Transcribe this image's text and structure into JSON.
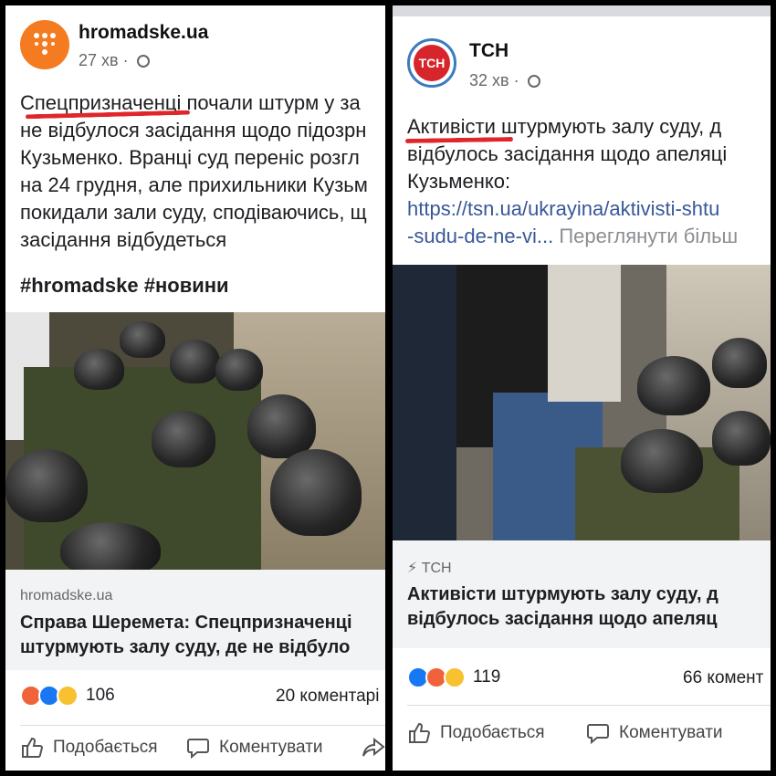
{
  "left_post": {
    "page_name": "hromadske.ua",
    "time": "27 хв",
    "text_lines": [
      "Спецпризначенці почали штурм у за",
      "не відбулося засідання щодо підозрн",
      "Кузьменко. Вранці суд переніс розгл",
      "на 24 грудня, але прихильники Кузьм",
      "покидали зали суду, сподіваючись, щ",
      "засідання відбудеться"
    ],
    "hashtags": "#hromadske #новини",
    "card_domain": "hromadske.ua",
    "card_title_lines": [
      "Справа Шеремета: Спецпризначенці",
      "штурмують залу суду, де не відбуло"
    ],
    "reaction_count": "106",
    "comments": "20 коментарі",
    "like_label": "Подобається",
    "comment_label": "Коментувати",
    "colors": {
      "avatar": "#f47b20",
      "underline": "#e0262a"
    }
  },
  "right_post": {
    "page_name": "ТСН",
    "avatar_text": "ТСН",
    "time": "32 хв",
    "text_lines": [
      "Активісти штурмують залу суду, д",
      "відбулось засідання щодо апеляці",
      "Кузьменко:"
    ],
    "link_line": "https://tsn.ua/ukrayina/aktivisti-shtu",
    "link_tail": "-sudu-de-ne-vi...",
    "see_more": "Переглянути більш",
    "card_domain": "ТСН",
    "card_title_lines": [
      "Активісти штурмують залу суду, д",
      "відбулось засідання щодо апеляц"
    ],
    "reaction_count": "119",
    "comments": "66 комент",
    "like_label": "Подобається",
    "comment_label": "Коментувати",
    "colors": {
      "avatar": "#d7262b"
    }
  }
}
